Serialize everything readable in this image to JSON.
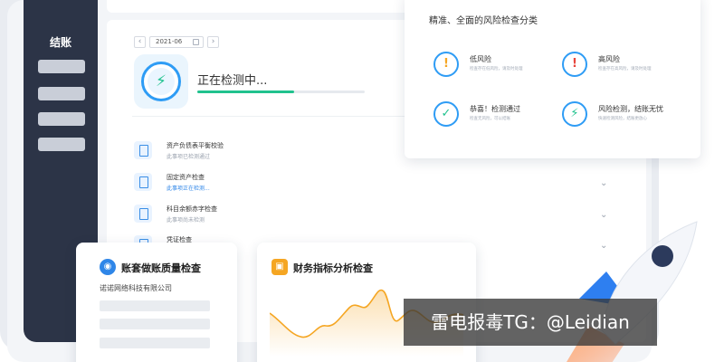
{
  "sidebar": {
    "title": "结账"
  },
  "main": {
    "date_prev": "‹",
    "date_value": "2021-06",
    "date_next": "›",
    "status_text": "正在检测中...",
    "progress_fraction": 0.58,
    "items": [
      {
        "name": "资产负债表平衡校验",
        "sub": "此事项已检测通过",
        "sub_color": "gray"
      },
      {
        "name": "固定资产检查",
        "sub": "此事项正在检测...",
        "sub_color": "blue"
      },
      {
        "name": "科目余额赤字检查",
        "sub": "此事项尚未检测",
        "sub_color": "gray"
      },
      {
        "name": "凭证检查",
        "sub": "",
        "sub_color": "gray"
      }
    ]
  },
  "risk_panel": {
    "title": "精准、全面的风险检查分类",
    "categories": [
      {
        "label": "低风险",
        "desc": "检查存在低风险，请及时处理",
        "icon": "exclamation-icon",
        "glyph": "!"
      },
      {
        "label": "高风险",
        "desc": "检查存在高风险，请及时处理",
        "icon": "exclamation-icon",
        "glyph": "!"
      },
      {
        "label": "恭喜！检测通过",
        "desc": "检查无风险，可以结账",
        "icon": "check-icon",
        "glyph": "✓"
      },
      {
        "label": "风险检测，结账无忧",
        "desc": "快速检测风险，结账更放心",
        "icon": "bolt-icon",
        "glyph": "⚡"
      }
    ]
  },
  "account_card": {
    "title": "账套做账质量检查",
    "company": "诺诺网络科技有限公司"
  },
  "finance_card": {
    "title": "财务指标分析检查"
  },
  "watermark": "雷电报毒TG：@Leidian",
  "colors": {
    "accent_blue": "#2e9cf5",
    "success_green": "#21c28e",
    "warning_orange": "#f5a623",
    "danger_red": "#e8453c",
    "sidebar_dark": "#2c3447"
  }
}
